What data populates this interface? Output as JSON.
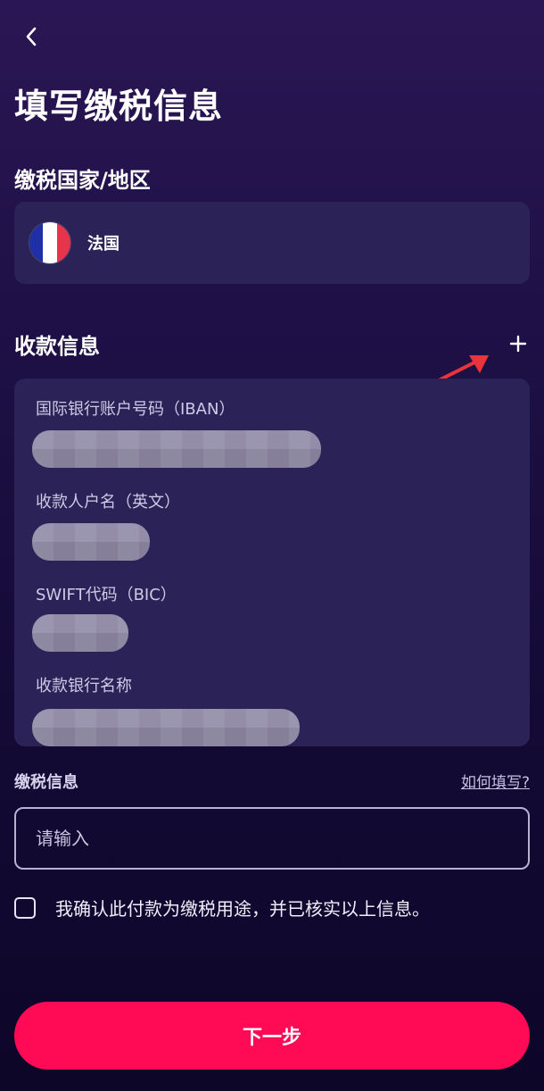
{
  "header": {
    "back_icon": "chevron-left-icon",
    "title": "填写缴税信息"
  },
  "country_section": {
    "label": "缴税国家/地区",
    "selected_country": "法国",
    "flag_colors": [
      "#1f2fa8",
      "#ffffff",
      "#e8344a"
    ]
  },
  "payee_section": {
    "label": "收款信息",
    "add_icon": "plus-icon",
    "fields": [
      {
        "label": "国际银行账户号码（IBAN）"
      },
      {
        "label": "收款人户名（英文）"
      },
      {
        "label": "SWIFT代码（BIC）"
      },
      {
        "label": "收款银行名称"
      }
    ]
  },
  "tax_section": {
    "label": "缴税信息",
    "help_link": "如何填写?",
    "input_placeholder": "请输入",
    "input_value": ""
  },
  "confirm": {
    "checked": false,
    "text": "我确认此付款为缴税用途，并已核实以上信息。"
  },
  "next_button": {
    "label": "下一步"
  },
  "colors": {
    "accent": "#ff0a54",
    "card": "#2b2357",
    "annotation_arrow": "#e8343a"
  }
}
